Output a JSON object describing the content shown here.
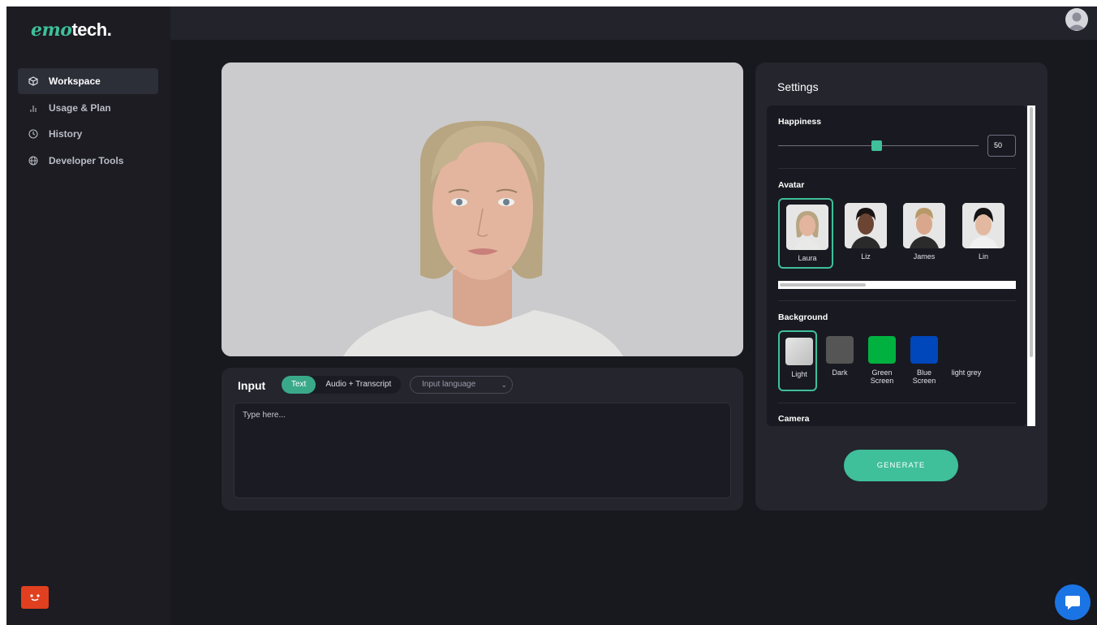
{
  "app": {
    "logo_prefix": "emo",
    "logo_suffix": "tech."
  },
  "sidebar": {
    "items": [
      {
        "label": "Workspace",
        "icon": "cube-icon",
        "active": true
      },
      {
        "label": "Usage & Plan",
        "icon": "bar-chart-icon",
        "active": false
      },
      {
        "label": "History",
        "icon": "clock-icon",
        "active": false
      },
      {
        "label": "Developer Tools",
        "icon": "globe-icon",
        "active": false
      }
    ]
  },
  "input": {
    "title": "Input",
    "modes": [
      "Text",
      "Audio + Transcript"
    ],
    "active_mode": "Text",
    "language_placeholder": "Input language",
    "text_placeholder": "Type here..."
  },
  "settings": {
    "title": "Settings",
    "happiness": {
      "label": "Happiness",
      "value": "50",
      "slider_fraction": 0.5
    },
    "avatar": {
      "label": "Avatar",
      "options": [
        "Laura",
        "Liz",
        "James",
        "Lin"
      ],
      "selected": "Laura"
    },
    "background": {
      "label": "Background",
      "options": [
        {
          "name": "Light",
          "color": "#d8d8d8"
        },
        {
          "name": "Dark",
          "color": "#555555"
        },
        {
          "name": "Green Screen",
          "color": "#00b140"
        },
        {
          "name": "Blue Screen",
          "color": "#0047bb"
        },
        {
          "name": "light grey",
          "color": ""
        }
      ],
      "selected": "Light"
    },
    "camera": {
      "label": "Camera"
    },
    "generate_label": "GENERATE"
  },
  "colors": {
    "accent": "#3fbf9a",
    "sidebar_bg": "#1c1c22",
    "main_bg": "#18181f",
    "panel_bg": "#24252d"
  }
}
